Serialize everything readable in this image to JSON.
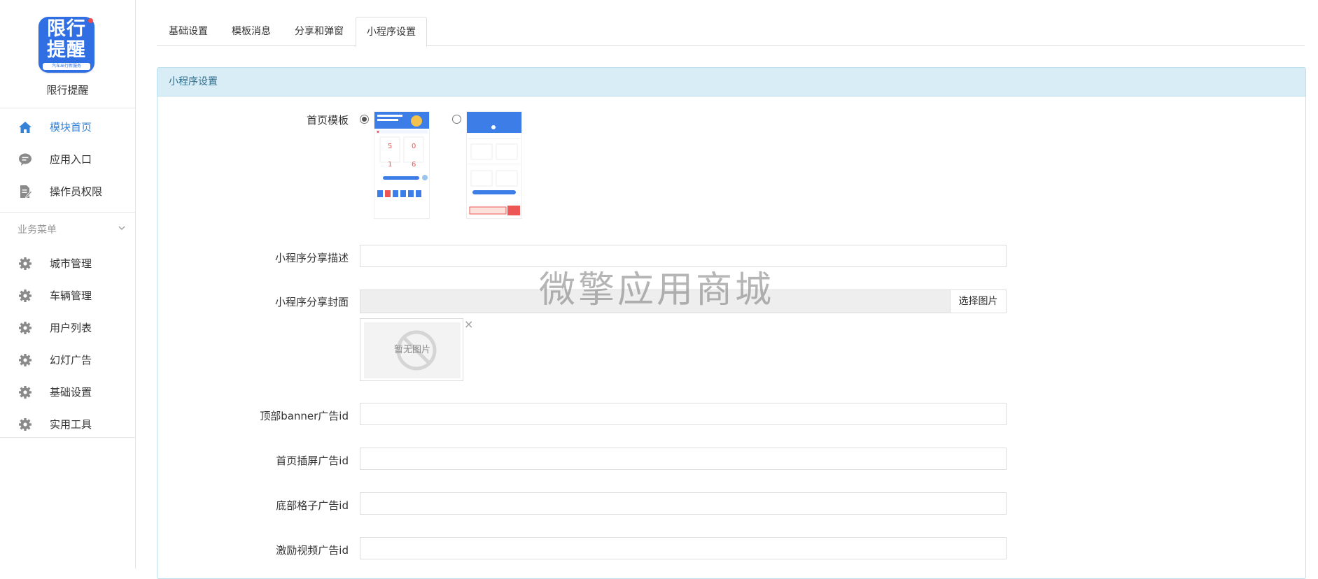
{
  "app": {
    "logo_line1": "限行",
    "logo_line2": "提醒",
    "logo_sub": "汽车出行新服务",
    "name": "限行提醒"
  },
  "sidebar": {
    "top_items": [
      {
        "label": "模块首页",
        "icon": "home-icon",
        "active": true
      },
      {
        "label": "应用入口",
        "icon": "chat-bubble-icon",
        "active": false
      },
      {
        "label": "操作员权限",
        "icon": "edit-document-icon",
        "active": false
      }
    ],
    "group_title": "业务菜单",
    "group_items": [
      {
        "label": "城市管理",
        "icon": "gear-icon"
      },
      {
        "label": "车辆管理",
        "icon": "gear-icon"
      },
      {
        "label": "用户列表",
        "icon": "gear-icon"
      },
      {
        "label": "幻灯广告",
        "icon": "gear-icon"
      },
      {
        "label": "基础设置",
        "icon": "gear-icon"
      },
      {
        "label": "实用工具",
        "icon": "gear-icon"
      }
    ]
  },
  "tabs": [
    {
      "label": "基础设置",
      "active": false
    },
    {
      "label": "模板消息",
      "active": false
    },
    {
      "label": "分享和弹窗",
      "active": false
    },
    {
      "label": "小程序设置",
      "active": true
    }
  ],
  "panel": {
    "title": "小程序设置",
    "home_template_label": "首页模板",
    "share_desc_label": "小程序分享描述",
    "share_desc_value": "",
    "share_cover_label": "小程序分享封面",
    "share_cover_value": "",
    "pick_image_label": "选择图片",
    "no_image_text": "暂无图片",
    "close_symbol": "×",
    "top_banner_label": "顶部banner广告id",
    "home_interstitial_label": "首页插屏广告id",
    "bottom_grid_label": "底部格子广告id",
    "reward_video_label": "激励视频广告id"
  },
  "watermark": "微擎应用商城",
  "colors": {
    "accent": "#3582d6",
    "panel_header_bg": "#d9edf7",
    "panel_header_text": "#31708f",
    "logo_blue": "#2f6fe3"
  }
}
